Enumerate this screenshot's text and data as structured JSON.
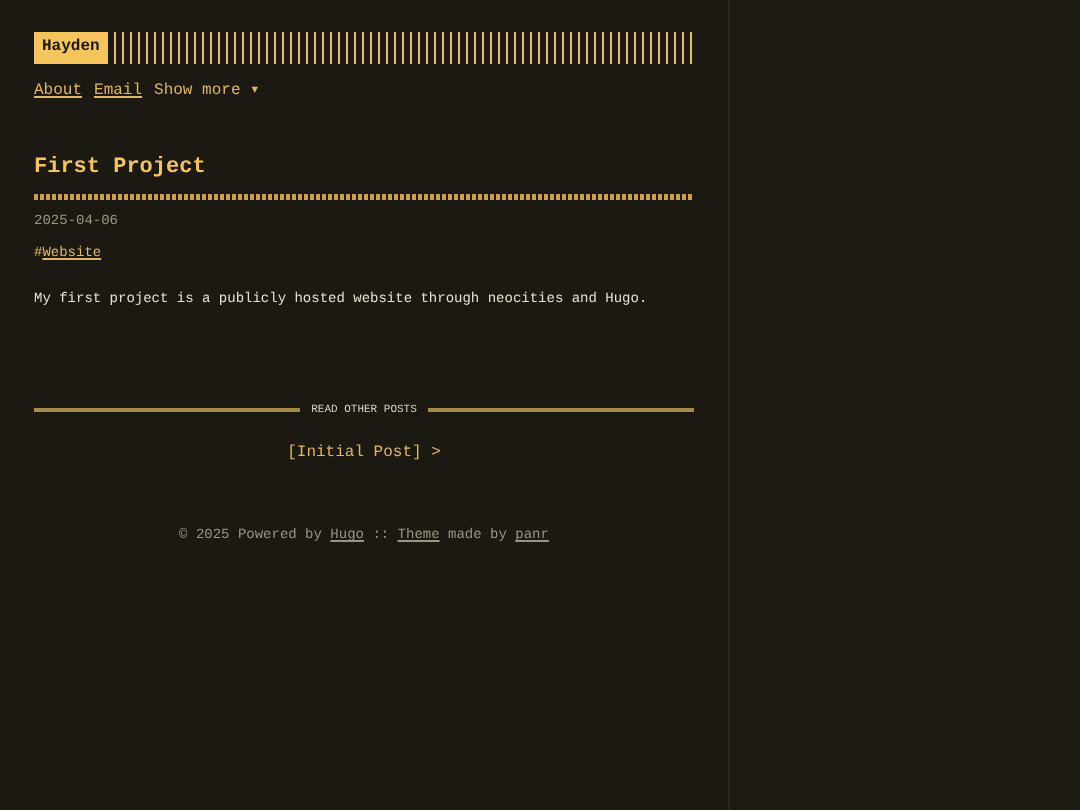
{
  "logo": {
    "text": "Hayden"
  },
  "nav": [
    {
      "label": "About",
      "kind": "link"
    },
    {
      "label": "Email",
      "kind": "link"
    },
    {
      "label": "Show more ▾",
      "kind": "menu"
    }
  ],
  "post": {
    "title": "First Project",
    "date": "2025-04-06",
    "tag_prefix": "#",
    "tag": "Website",
    "body": "My first project is a publicly hosted website through neocities and Hugo."
  },
  "other_posts": {
    "heading": "READ OTHER POSTS",
    "link": "[Initial Post] >"
  },
  "footer": {
    "copyright": "© 2025 Powered by",
    "hugo": "Hugo",
    "separator": "::",
    "theme": "Theme",
    "made_by": "made by",
    "author": "panr"
  }
}
